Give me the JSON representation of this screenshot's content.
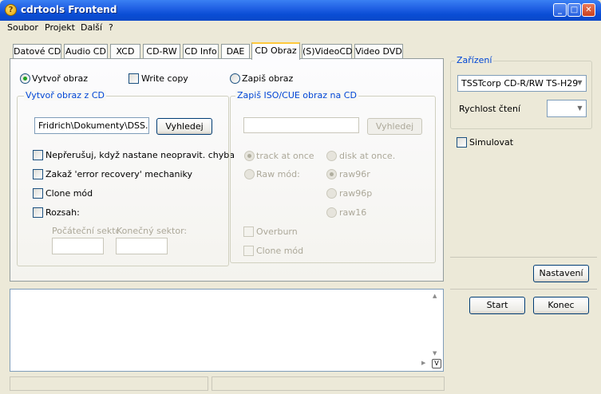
{
  "window": {
    "title": "cdrtools Frontend"
  },
  "menu": [
    "Soubor",
    "Projekt",
    "Další",
    "?"
  ],
  "tabs": [
    "Datové CD",
    "Audio CD",
    "XCD",
    "CD-RW",
    "CD Info",
    "DAE",
    "CD Obraz",
    "(S)VideoCD",
    "Video DVD"
  ],
  "active_tab": "CD Obraz",
  "mode": {
    "create_image": "Vytvoř obraz",
    "write_copy": "Write copy",
    "write_image": "Zapiš obraz"
  },
  "create_group": {
    "title": "Vytvoř obraz z CD",
    "path_value": "Fridrich\\Dokumenty\\DSS.iso",
    "browse": "Vyhledej",
    "opt_no_abort": "Nepřerušuj, když nastane neopravit. chyba",
    "opt_no_recovery": "Zakaž 'error recovery' mechaniky",
    "opt_clone": "Clone mód",
    "opt_range": "Rozsah:",
    "start_sector": "Počáteční sektor",
    "end_sector": "Konečný sektor:",
    "start_value": "",
    "end_value": ""
  },
  "write_group": {
    "title": "Zapiš ISO/CUE obraz na CD",
    "path_value": "",
    "browse": "Vyhledej",
    "track_at_once": "track at once",
    "disk_at_once": "disk at once.",
    "raw_mode": "Raw mód:",
    "raw96r": "raw96r",
    "raw96p": "raw96p",
    "raw16": "raw16",
    "overburn": "Overburn",
    "clone": "Clone mód"
  },
  "device": {
    "title": "Zařízení",
    "drive": "TSSTcorp CD-R/RW TS-H29",
    "read_speed_label": "Rychlost čtení",
    "read_speed_value": "",
    "simulate": "Simulovat"
  },
  "buttons": {
    "settings": "Nastavení",
    "start": "Start",
    "quit": "Konec"
  },
  "log": {
    "text": ""
  },
  "status": {
    "left": "",
    "right": ""
  }
}
